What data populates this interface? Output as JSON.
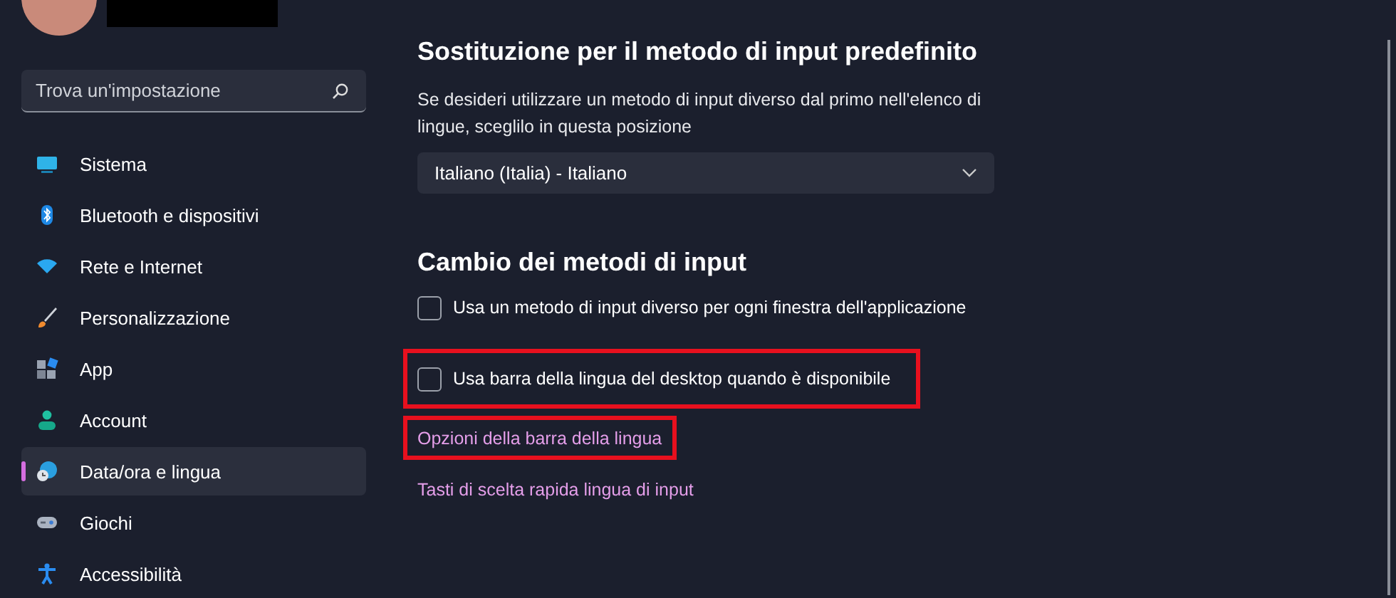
{
  "search": {
    "placeholder": "Trova un'impostazione"
  },
  "nav": [
    {
      "label": "Sistema",
      "kind": "system",
      "selected": false
    },
    {
      "label": "Bluetooth e dispositivi",
      "kind": "bluetooth",
      "selected": false
    },
    {
      "label": "Rete e Internet",
      "kind": "wifi",
      "selected": false
    },
    {
      "label": "Personalizzazione",
      "kind": "brush",
      "selected": false
    },
    {
      "label": "App",
      "kind": "apps",
      "selected": false
    },
    {
      "label": "Account",
      "kind": "person",
      "selected": false
    },
    {
      "label": "Data/ora e lingua",
      "kind": "globe",
      "selected": true
    },
    {
      "label": "Giochi",
      "kind": "gamepad",
      "selected": false
    },
    {
      "label": "Accessibilità",
      "kind": "accessibility",
      "selected": false
    }
  ],
  "sections": [
    {
      "heading": "Sostituzione per il metodo di input predefinito",
      "description": "Se desideri utilizzare un metodo di input diverso dal primo nell'elenco di lingue, sceglilo in questa posizione",
      "dropdown": {
        "value": "Italiano (Italia) - Italiano"
      }
    },
    {
      "heading": "Cambio dei metodi di input",
      "options": [
        {
          "label": "Usa un metodo di input diverso per ogni finestra dell'applicazione",
          "checked": false,
          "highlighted": false
        },
        {
          "label": "Usa barra della lingua del desktop quando è disponibile",
          "checked": false,
          "highlighted": true
        }
      ],
      "links": [
        {
          "label": "Opzioni della barra della lingua",
          "highlighted": true
        },
        {
          "label": "Tasti di scelta rapida lingua di input",
          "highlighted": false
        }
      ]
    }
  ]
}
